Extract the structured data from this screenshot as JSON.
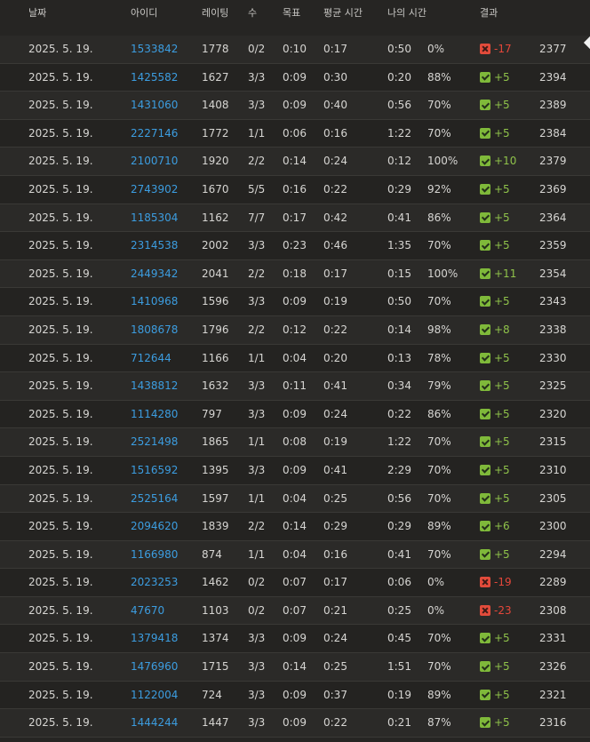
{
  "header": {
    "date": "날짜",
    "id": "아이디",
    "rating": "레이팅",
    "count": "수",
    "goal": "목표",
    "avg_time": "평균 시간",
    "my_time": "나의 시간",
    "result": "결과"
  },
  "colors": {
    "link": "#3c9de0",
    "win": "#7fb93a",
    "loss": "#e24b3b"
  },
  "rows": [
    {
      "date": "2025. 5. 19.",
      "id": "1533842",
      "rating": "1778",
      "count": "0/2",
      "goal": "0:10",
      "avg": "0:17",
      "my": "0:50",
      "pct": "0%",
      "result": "loss",
      "delta": "-17",
      "score": "2377"
    },
    {
      "date": "2025. 5. 19.",
      "id": "1425582",
      "rating": "1627",
      "count": "3/3",
      "goal": "0:09",
      "avg": "0:30",
      "my": "0:20",
      "pct": "88%",
      "result": "win",
      "delta": "+5",
      "score": "2394"
    },
    {
      "date": "2025. 5. 19.",
      "id": "1431060",
      "rating": "1408",
      "count": "3/3",
      "goal": "0:09",
      "avg": "0:40",
      "my": "0:56",
      "pct": "70%",
      "result": "win",
      "delta": "+5",
      "score": "2389"
    },
    {
      "date": "2025. 5. 19.",
      "id": "2227146",
      "rating": "1772",
      "count": "1/1",
      "goal": "0:06",
      "avg": "0:16",
      "my": "1:22",
      "pct": "70%",
      "result": "win",
      "delta": "+5",
      "score": "2384"
    },
    {
      "date": "2025. 5. 19.",
      "id": "2100710",
      "rating": "1920",
      "count": "2/2",
      "goal": "0:14",
      "avg": "0:24",
      "my": "0:12",
      "pct": "100%",
      "result": "win",
      "delta": "+10",
      "score": "2379"
    },
    {
      "date": "2025. 5. 19.",
      "id": "2743902",
      "rating": "1670",
      "count": "5/5",
      "goal": "0:16",
      "avg": "0:22",
      "my": "0:29",
      "pct": "92%",
      "result": "win",
      "delta": "+5",
      "score": "2369"
    },
    {
      "date": "2025. 5. 19.",
      "id": "1185304",
      "rating": "1162",
      "count": "7/7",
      "goal": "0:17",
      "avg": "0:42",
      "my": "0:41",
      "pct": "86%",
      "result": "win",
      "delta": "+5",
      "score": "2364"
    },
    {
      "date": "2025. 5. 19.",
      "id": "2314538",
      "rating": "2002",
      "count": "3/3",
      "goal": "0:23",
      "avg": "0:46",
      "my": "1:35",
      "pct": "70%",
      "result": "win",
      "delta": "+5",
      "score": "2359"
    },
    {
      "date": "2025. 5. 19.",
      "id": "2449342",
      "rating": "2041",
      "count": "2/2",
      "goal": "0:18",
      "avg": "0:17",
      "my": "0:15",
      "pct": "100%",
      "result": "win",
      "delta": "+11",
      "score": "2354"
    },
    {
      "date": "2025. 5. 19.",
      "id": "1410968",
      "rating": "1596",
      "count": "3/3",
      "goal": "0:09",
      "avg": "0:19",
      "my": "0:50",
      "pct": "70%",
      "result": "win",
      "delta": "+5",
      "score": "2343"
    },
    {
      "date": "2025. 5. 19.",
      "id": "1808678",
      "rating": "1796",
      "count": "2/2",
      "goal": "0:12",
      "avg": "0:22",
      "my": "0:14",
      "pct": "98%",
      "result": "win",
      "delta": "+8",
      "score": "2338"
    },
    {
      "date": "2025. 5. 19.",
      "id": "712644",
      "rating": "1166",
      "count": "1/1",
      "goal": "0:04",
      "avg": "0:20",
      "my": "0:13",
      "pct": "78%",
      "result": "win",
      "delta": "+5",
      "score": "2330"
    },
    {
      "date": "2025. 5. 19.",
      "id": "1438812",
      "rating": "1632",
      "count": "3/3",
      "goal": "0:11",
      "avg": "0:41",
      "my": "0:34",
      "pct": "79%",
      "result": "win",
      "delta": "+5",
      "score": "2325"
    },
    {
      "date": "2025. 5. 19.",
      "id": "1114280",
      "rating": "797",
      "count": "3/3",
      "goal": "0:09",
      "avg": "0:24",
      "my": "0:22",
      "pct": "86%",
      "result": "win",
      "delta": "+5",
      "score": "2320"
    },
    {
      "date": "2025. 5. 19.",
      "id": "2521498",
      "rating": "1865",
      "count": "1/1",
      "goal": "0:08",
      "avg": "0:19",
      "my": "1:22",
      "pct": "70%",
      "result": "win",
      "delta": "+5",
      "score": "2315"
    },
    {
      "date": "2025. 5. 19.",
      "id": "1516592",
      "rating": "1395",
      "count": "3/3",
      "goal": "0:09",
      "avg": "0:41",
      "my": "2:29",
      "pct": "70%",
      "result": "win",
      "delta": "+5",
      "score": "2310"
    },
    {
      "date": "2025. 5. 19.",
      "id": "2525164",
      "rating": "1597",
      "count": "1/1",
      "goal": "0:04",
      "avg": "0:25",
      "my": "0:56",
      "pct": "70%",
      "result": "win",
      "delta": "+5",
      "score": "2305"
    },
    {
      "date": "2025. 5. 19.",
      "id": "2094620",
      "rating": "1839",
      "count": "2/2",
      "goal": "0:14",
      "avg": "0:29",
      "my": "0:29",
      "pct": "89%",
      "result": "win",
      "delta": "+6",
      "score": "2300"
    },
    {
      "date": "2025. 5. 19.",
      "id": "1166980",
      "rating": "874",
      "count": "1/1",
      "goal": "0:04",
      "avg": "0:16",
      "my": "0:41",
      "pct": "70%",
      "result": "win",
      "delta": "+5",
      "score": "2294"
    },
    {
      "date": "2025. 5. 19.",
      "id": "2023253",
      "rating": "1462",
      "count": "0/2",
      "goal": "0:07",
      "avg": "0:17",
      "my": "0:06",
      "pct": "0%",
      "result": "loss",
      "delta": "-19",
      "score": "2289"
    },
    {
      "date": "2025. 5. 19.",
      "id": "47670",
      "rating": "1103",
      "count": "0/2",
      "goal": "0:07",
      "avg": "0:21",
      "my": "0:25",
      "pct": "0%",
      "result": "loss",
      "delta": "-23",
      "score": "2308"
    },
    {
      "date": "2025. 5. 19.",
      "id": "1379418",
      "rating": "1374",
      "count": "3/3",
      "goal": "0:09",
      "avg": "0:24",
      "my": "0:45",
      "pct": "70%",
      "result": "win",
      "delta": "+5",
      "score": "2331"
    },
    {
      "date": "2025. 5. 19.",
      "id": "1476960",
      "rating": "1715",
      "count": "3/3",
      "goal": "0:14",
      "avg": "0:25",
      "my": "1:51",
      "pct": "70%",
      "result": "win",
      "delta": "+5",
      "score": "2326"
    },
    {
      "date": "2025. 5. 19.",
      "id": "1122004",
      "rating": "724",
      "count": "3/3",
      "goal": "0:09",
      "avg": "0:37",
      "my": "0:19",
      "pct": "89%",
      "result": "win",
      "delta": "+5",
      "score": "2321"
    },
    {
      "date": "2025. 5. 19.",
      "id": "1444244",
      "rating": "1447",
      "count": "3/3",
      "goal": "0:09",
      "avg": "0:22",
      "my": "0:21",
      "pct": "87%",
      "result": "win",
      "delta": "+5",
      "score": "2316"
    }
  ]
}
